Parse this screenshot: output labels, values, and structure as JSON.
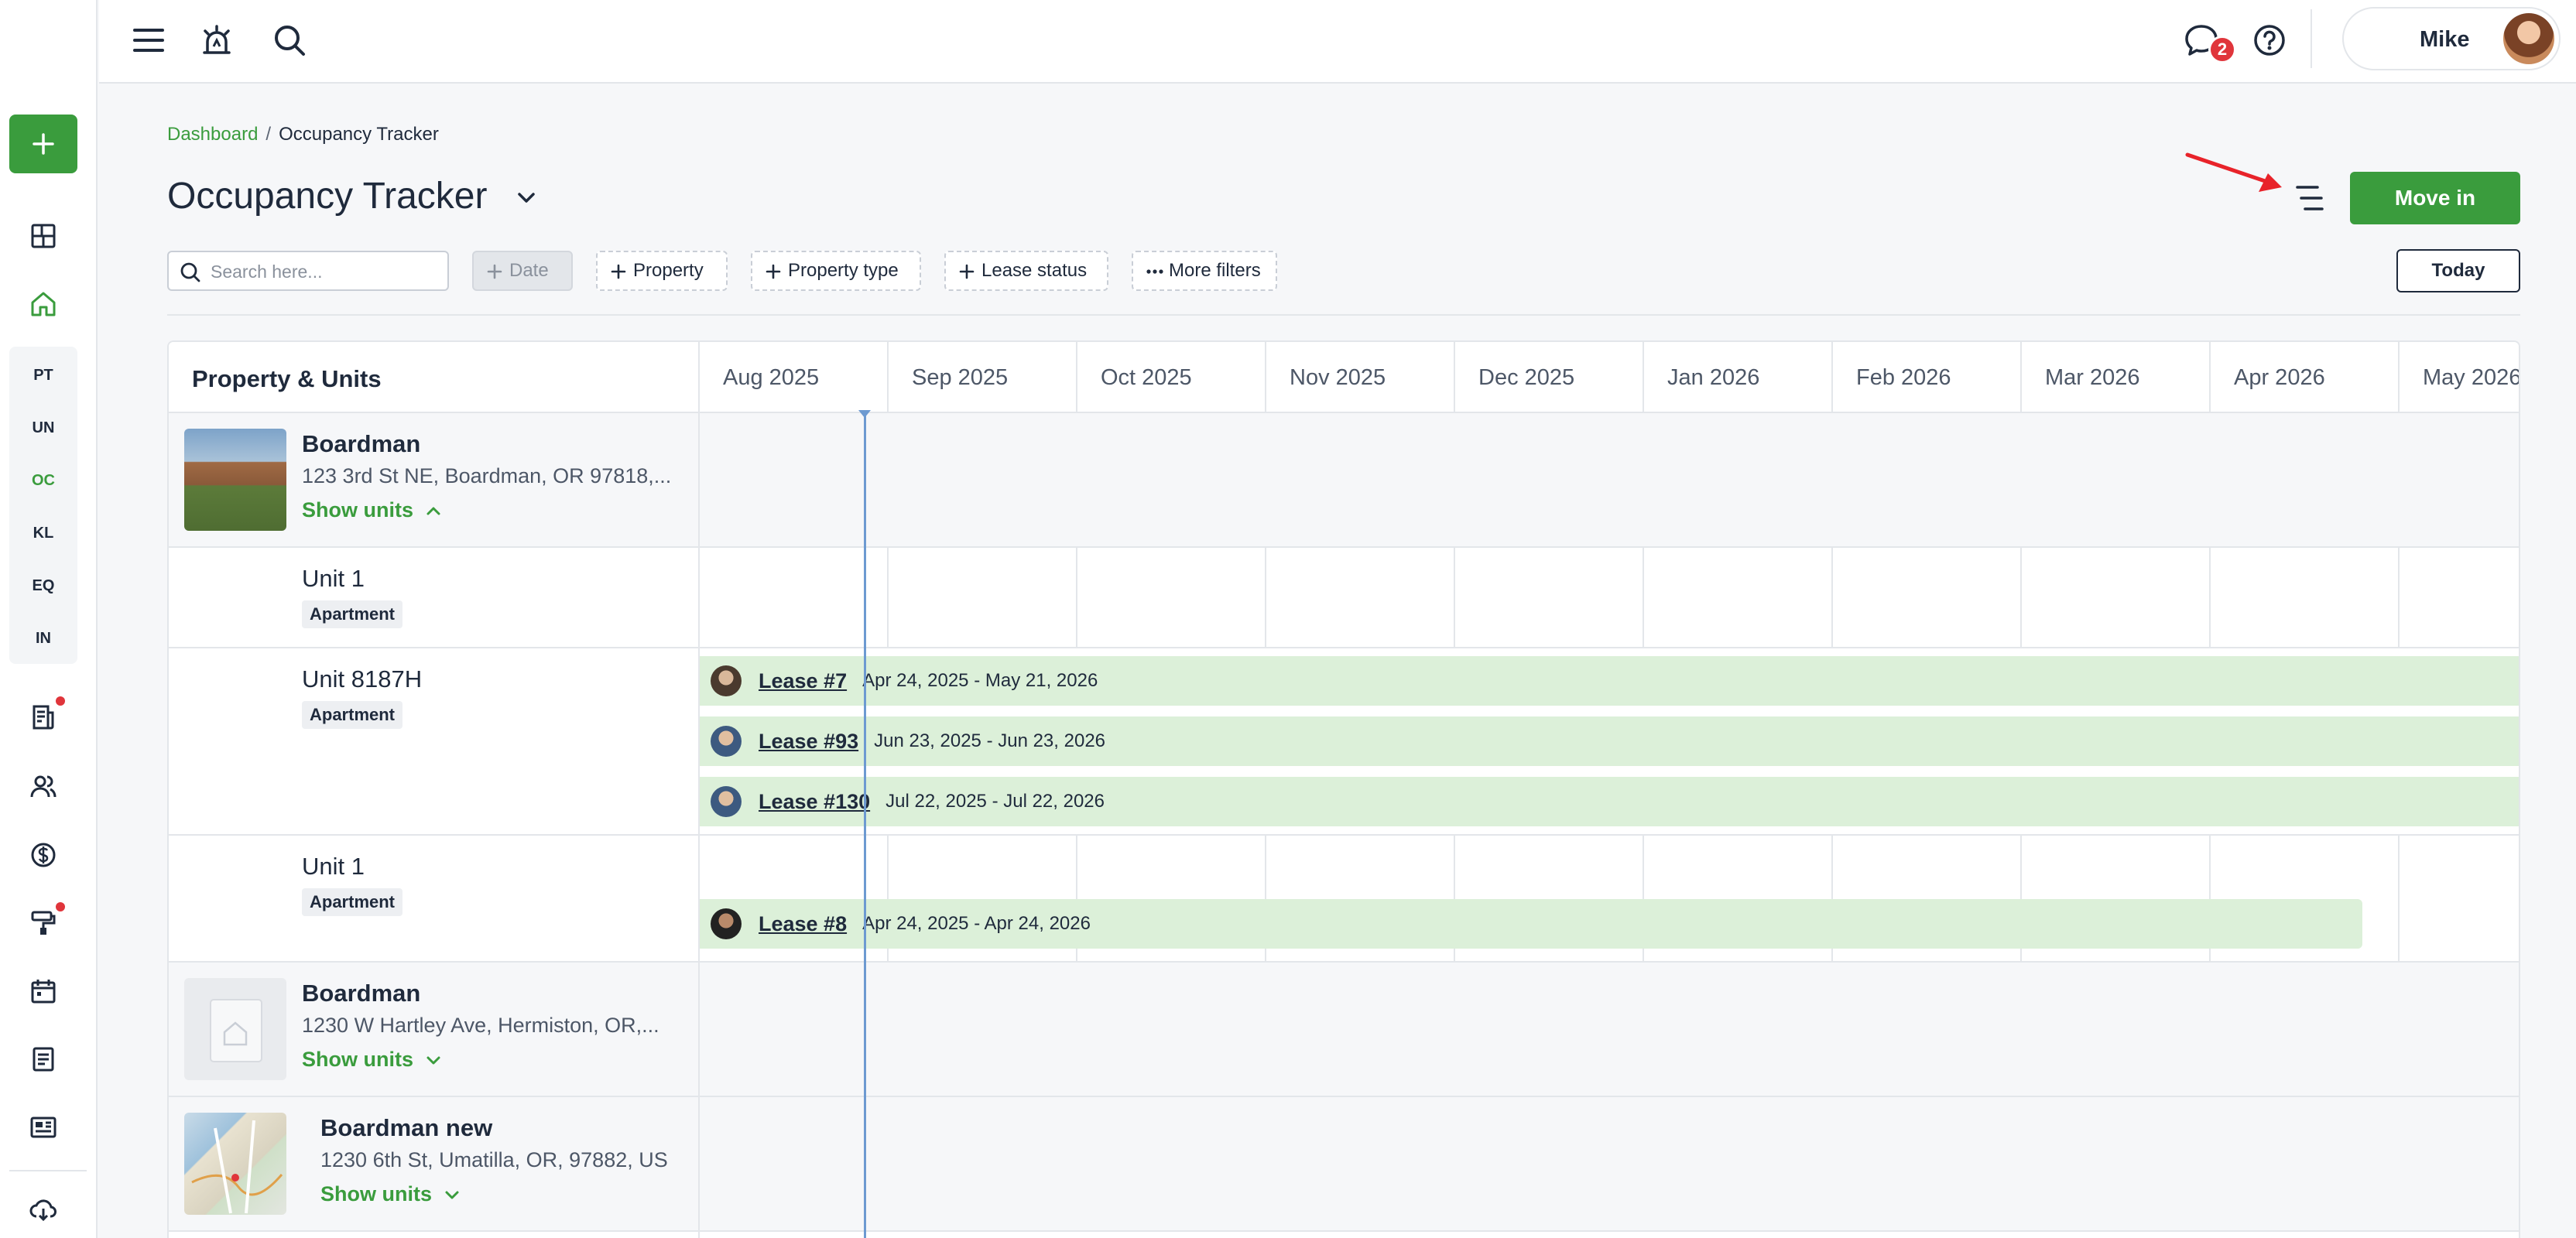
{
  "sidebar": {
    "add_label": "+",
    "codes": [
      {
        "code": "PT",
        "active": false
      },
      {
        "code": "UN",
        "active": false
      },
      {
        "code": "OC",
        "active": true
      },
      {
        "code": "KL",
        "active": false
      },
      {
        "code": "EQ",
        "active": false
      },
      {
        "code": "IN",
        "active": false
      }
    ]
  },
  "topbar": {
    "messages_badge": "2",
    "user_name": "Mike"
  },
  "breadcrumb": {
    "root": "Dashboard",
    "separator": "/",
    "current": "Occupancy Tracker"
  },
  "page": {
    "title": "Occupancy Tracker",
    "primary_action": "Move in"
  },
  "filters": {
    "search_placeholder": "Search here...",
    "date": "Date",
    "property": "Property",
    "property_type": "Property type",
    "lease_status": "Lease status",
    "more": "More filters",
    "today": "Today"
  },
  "grid": {
    "left_header": "Property & Units",
    "months": [
      "Aug 2025",
      "Sep 2025",
      "Oct 2025",
      "Nov 2025",
      "Dec 2025",
      "Jan 2026",
      "Feb 2026",
      "Mar 2026",
      "Apr 2026",
      "May 2026"
    ],
    "properties": [
      {
        "name": "Boardman",
        "address": "123 3rd St NE, Boardman, OR 97818,...",
        "show_units": "Show units",
        "units": [
          {
            "name": "Unit 1",
            "type": "Apartment",
            "leases": []
          },
          {
            "name": "Unit 8187H",
            "type": "Apartment",
            "leases": [
              {
                "label": "Lease #7",
                "dates": "Apr 24, 2025 - May 21, 2026"
              },
              {
                "label": "Lease #93",
                "dates": "Jun 23, 2025 - Jun 23, 2026"
              },
              {
                "label": "Lease #130",
                "dates": "Jul 22, 2025 - Jul 22, 2026"
              }
            ]
          },
          {
            "name": "Unit 1",
            "type": "Apartment",
            "leases": [
              {
                "label": "Lease #8",
                "dates": "Apr 24, 2025 - Apr 24, 2026"
              }
            ]
          }
        ]
      },
      {
        "name": "Boardman",
        "address": "1230 W Hartley Ave, Hermiston, OR,...",
        "show_units": "Show units"
      },
      {
        "name": "Boardman new",
        "address": "1230 6th St, Umatilla, OR, 97882, US",
        "show_units": "Show units"
      }
    ]
  }
}
